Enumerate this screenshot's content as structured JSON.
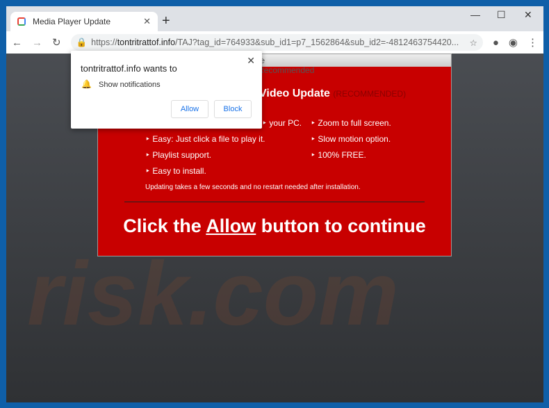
{
  "tab": {
    "title": "Media Player Update"
  },
  "address": {
    "scheme": "https://",
    "domain": "tontritrattof.info",
    "path": "/TAJ?tag_id=764933&sub_id1=p7_1562864&sub_id2=-4812463754420..."
  },
  "popup": {
    "title": "tontritrattof.info wants to",
    "permission": "Show notifications",
    "allow": "Allow",
    "block": "Block"
  },
  "page": {
    "header": "te Recommended",
    "headline": "Video Update",
    "headline_tag": "(RECOMMENDED)",
    "features": [
      "your PC.",
      "Easy: Just click a file to play it.",
      "Playlist support.",
      "Easy to install.",
      "Zoom to full screen.",
      "Slow motion option.",
      "100% FREE."
    ],
    "note": "Updating takes a few seconds and no restart needed after installation.",
    "cta_pre": "Click the ",
    "cta_link": "Allow",
    "cta_post": " button to continue"
  },
  "watermark": "risk.com"
}
